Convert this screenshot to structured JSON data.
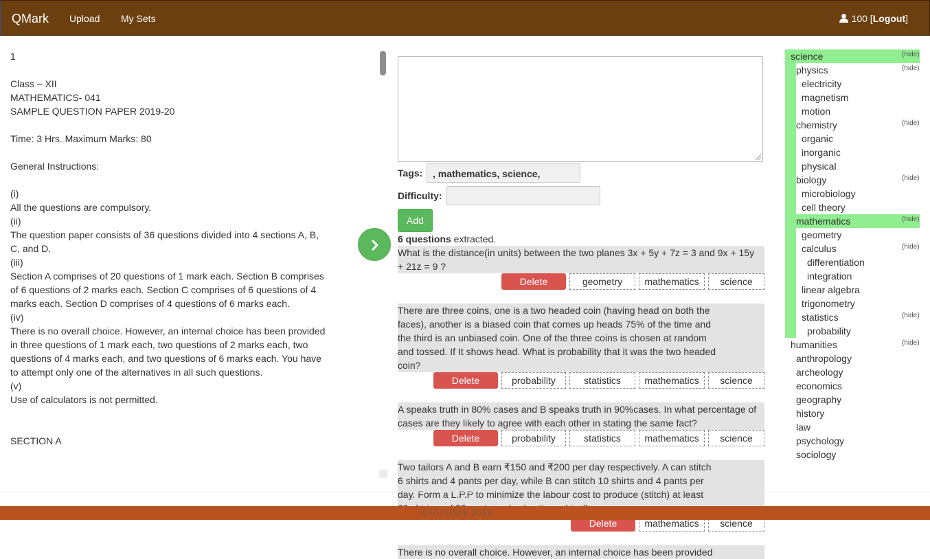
{
  "navbar": {
    "brand": "QMark",
    "links": [
      "Upload",
      "My Sets"
    ],
    "user_label": "100",
    "logout_label": "Logout",
    "user_icon": "user-icon"
  },
  "document": {
    "lines": [
      "1",
      "",
      "Class – XII",
      "MATHEMATICS- 041",
      "SAMPLE QUESTION PAPER 2019-20",
      "",
      "Time: 3 Hrs. Maximum Marks: 80",
      "",
      "General Instructions:",
      "",
      "(i)",
      "All the questions are compulsory.",
      "(ii)",
      "The question paper consists of 36 questions divided into 4 sections A, B,",
      "C, and D.",
      "(iii)",
      "Section A comprises of 20 questions of 1 mark each. Section B comprises",
      "of 6 questions of 2 marks each. Section C comprises of 6 questions of 4",
      "marks each. Section D comprises of 4 questions of 6 marks each.",
      "(iv)",
      "There is no overall choice. However, an internal choice has been provided",
      "in three questions of 1 mark each, two questions of 2 marks each, two",
      "questions of 4 marks each, and two questions of 6 marks each. You have",
      "to attempt only one of the alternatives in all such questions.",
      "(v)",
      "Use of calculators is not permitted.",
      "",
      "",
      "SECTION A"
    ]
  },
  "editor": {
    "question_text": "",
    "tags_label": "Tags:",
    "tags_value": ", mathematics, science,",
    "difficulty_label": "Difficulty:",
    "difficulty_value": "",
    "add_label": "Add",
    "next_icon": "chevron-right-icon"
  },
  "extracted": {
    "count": "6 questions",
    "suffix": " extracted.",
    "delete_label": "Delete",
    "questions": [
      {
        "lines": [
          "What is the distance(in units) between the two planes 3x + 5y + 7z = 3 and 9x + 15y",
          "+ 21z = 9 ?"
        ],
        "tags": [
          "geometry",
          "mathematics",
          "science"
        ]
      },
      {
        "lines": [
          "There are three coins, one is a two headed coin (having head on both the",
          "faces), another is a biased coin that comes up heads 75% of the time and",
          "the third is an unbiased coin. One of the three coins is chosen at random",
          "and tossed. If It shows head. What is probability that it was the two headed",
          "coin?"
        ],
        "tags": [
          "probability",
          "statistics",
          "mathematics",
          "science"
        ]
      },
      {
        "lines": [
          "A speaks truth in 80% cases and B speaks truth in 90%cases. In what percentage of",
          "cases are they likely to agree with each other in stating the same fact?"
        ],
        "tags": [
          "probability",
          "statistics",
          "mathematics",
          "science"
        ]
      },
      {
        "lines": [
          "Two tailors A and B earn ₹150 and ₹200 per day respectively. A can stitch",
          "6 shirts and 4 pants per day, while B can stitch 10 shirts and 4 pants per",
          "day. Form a L.P.P to minimize the labour cost to produce (stitch) at least",
          "60 shirts and 32 pants and solve it graphically."
        ],
        "tags": [
          "mathematics",
          "science"
        ]
      },
      {
        "lines": [
          "There is no overall choice. However, an internal choice has been provided"
        ],
        "tags": []
      }
    ]
  },
  "footer": {
    "text": "© PIYUSH, 2019"
  },
  "tree": {
    "hide_label": "(hide)",
    "nodes": [
      {
        "label": "science",
        "depth": 0,
        "hide": true
      },
      {
        "label": "physics",
        "depth": 1,
        "hide": true
      },
      {
        "label": "electricity",
        "depth": 2,
        "hide": false
      },
      {
        "label": "magnetism",
        "depth": 2,
        "hide": false
      },
      {
        "label": "motion",
        "depth": 2,
        "hide": false
      },
      {
        "label": "chemistry",
        "depth": 1,
        "hide": true
      },
      {
        "label": "organic",
        "depth": 2,
        "hide": false
      },
      {
        "label": "inorganic",
        "depth": 2,
        "hide": false
      },
      {
        "label": "physical",
        "depth": 2,
        "hide": false
      },
      {
        "label": "biology",
        "depth": 1,
        "hide": true
      },
      {
        "label": "microbiology",
        "depth": 2,
        "hide": false
      },
      {
        "label": "cell theory",
        "depth": 2,
        "hide": false
      },
      {
        "label": "mathematics",
        "depth": 1,
        "hide": true
      },
      {
        "label": "geometry",
        "depth": 2,
        "hide": false
      },
      {
        "label": "calculus",
        "depth": 2,
        "hide": true
      },
      {
        "label": "differentiation",
        "depth": 3,
        "hide": false
      },
      {
        "label": "integration",
        "depth": 3,
        "hide": false
      },
      {
        "label": "linear algebra",
        "depth": 2,
        "hide": false
      },
      {
        "label": "trigonometry",
        "depth": 2,
        "hide": false
      },
      {
        "label": "statistics",
        "depth": 2,
        "hide": true
      },
      {
        "label": "probability",
        "depth": 3,
        "hide": false
      },
      {
        "label": "humanities",
        "depth": 0,
        "hide": true
      },
      {
        "label": "anthropology",
        "depth": 1,
        "hide": false
      },
      {
        "label": "archeology",
        "depth": 1,
        "hide": false
      },
      {
        "label": "economics",
        "depth": 1,
        "hide": false
      },
      {
        "label": "geography",
        "depth": 1,
        "hide": false
      },
      {
        "label": "history",
        "depth": 1,
        "hide": false
      },
      {
        "label": "law",
        "depth": 1,
        "hide": false
      },
      {
        "label": "psychology",
        "depth": 1,
        "hide": false
      },
      {
        "label": "sociology",
        "depth": 1,
        "hide": false
      }
    ],
    "selected": [
      "science",
      "mathematics"
    ],
    "highlight_color": "#90ee90"
  },
  "colors": {
    "navbar": "#6b3f0f",
    "accent_green": "#5cb85c",
    "danger": "#d9534f",
    "footer": "#b8531f"
  }
}
